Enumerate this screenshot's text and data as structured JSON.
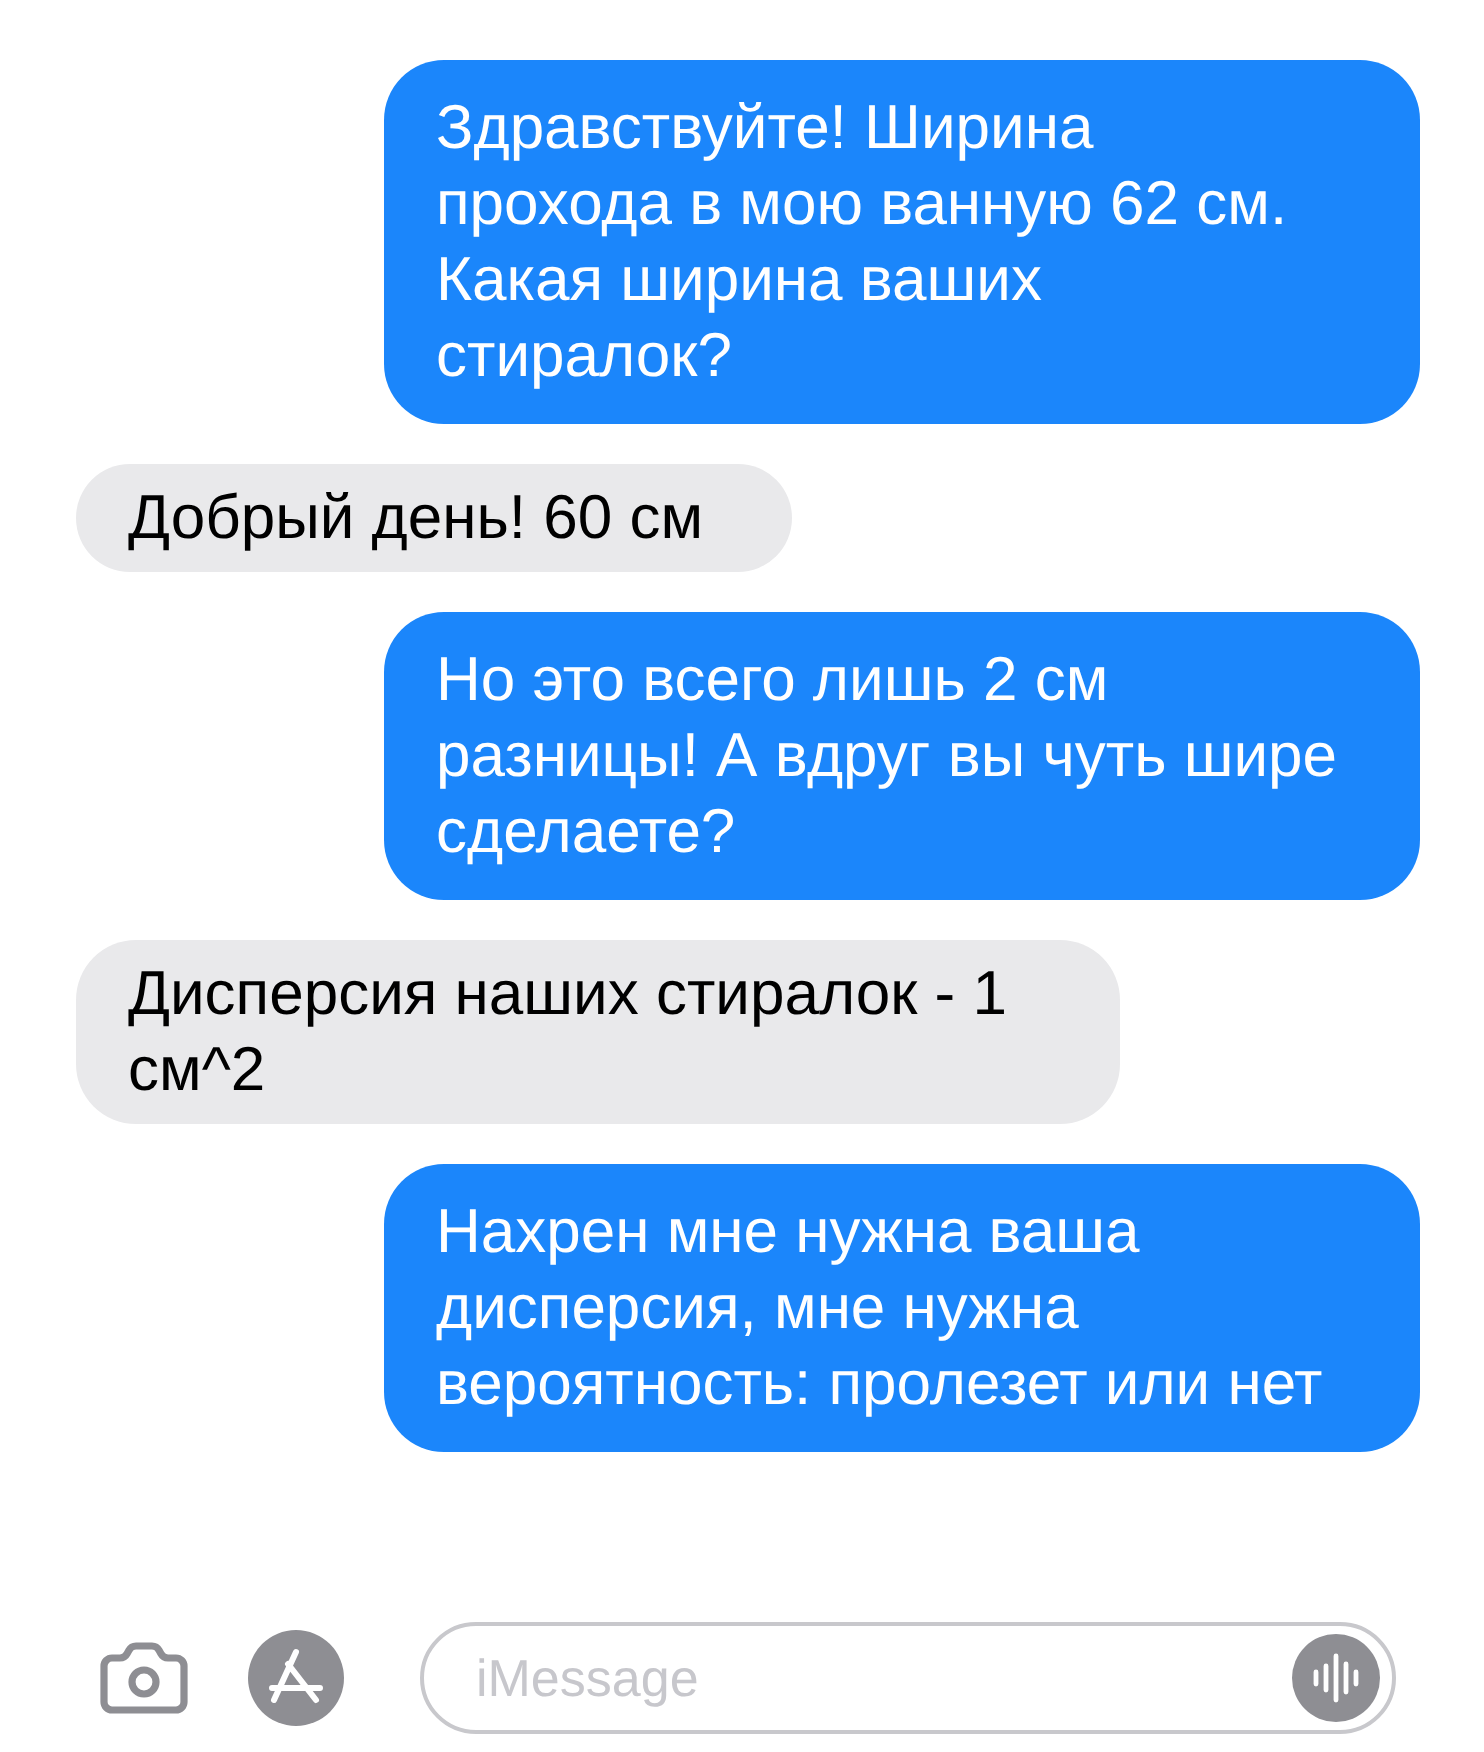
{
  "messages": [
    {
      "kind": "sent",
      "text": "Здравствуйте! Ширина прохода в мою ванную 62 см. Какая ширина ваших стиралок?"
    },
    {
      "kind": "received",
      "text": "Добрый день! 60 см"
    },
    {
      "kind": "sent",
      "text": "Но это всего лишь 2 см разницы! А вдруг вы чуть шире сделаете?"
    },
    {
      "kind": "received",
      "text": "Дисперсия наших стиралок - 1 см^2"
    },
    {
      "kind": "sent",
      "text": "Нахрен мне нужна ваша дисперсия, мне нужна вероятность: пролезет или нет"
    }
  ],
  "compose": {
    "placeholder": "iMessage"
  }
}
